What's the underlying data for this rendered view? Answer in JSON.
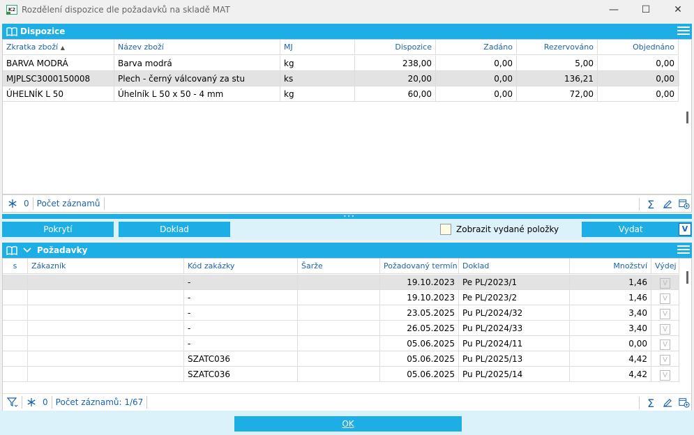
{
  "window": {
    "title": "Rozdělení dispozice dle požadavků na skladě MAT",
    "logo_text": "K2",
    "minimize": "—",
    "maximize": "☐",
    "close": "✕"
  },
  "dispozice": {
    "title": "Dispozice",
    "columns": [
      "Zkratka zboží",
      "Název zboží",
      "MJ",
      "Dispozice",
      "Zadáno",
      "Rezervováno",
      "Objednáno"
    ],
    "sort_indicator": "▲",
    "rows": [
      [
        "BARVA MODRÁ",
        "Barva modrá",
        "kg",
        "238,00",
        "0,00",
        "5,00",
        "0,00"
      ],
      [
        "MJPLSC3000150008",
        "Plech - černý válcovaný za stu",
        "ks",
        "20,00",
        "0,00",
        "136,21",
        "0,00"
      ],
      [
        "ÚHELNÍK L 50",
        "Úhelník L 50 x 50 - 4 mm",
        "kg",
        "60,00",
        "0,00",
        "72,00",
        "0,00"
      ]
    ],
    "footer": {
      "count": "0",
      "label": "Počet záznamů"
    }
  },
  "actions": {
    "pokryti": "Pokrytí",
    "doklad": "Doklad",
    "show_issued": "Zobrazit vydané položky",
    "vydat": "Vydat",
    "vydat_key": "V"
  },
  "pozadavky": {
    "title": "Požadavky",
    "columns": [
      "s",
      "Zákazník",
      "Kód zakázky",
      "Šarže",
      "Požadovaný termín",
      "Doklad",
      "Množství",
      "Výdej"
    ],
    "rows": [
      [
        "",
        "",
        "-",
        "",
        "19.10.2023",
        "Pe PL/2023/1",
        "1,46",
        "V"
      ],
      [
        "",
        "",
        "-",
        "",
        "19.10.2023",
        "Pe PL/2023/2",
        "1,46",
        "V"
      ],
      [
        "",
        "",
        "-",
        "",
        "23.05.2025",
        "Pu PL/2024/32",
        "3,40",
        "V"
      ],
      [
        "",
        "",
        "-",
        "",
        "26.05.2025",
        "Pu PL/2024/33",
        "3,40",
        "V"
      ],
      [
        "",
        "",
        "-",
        "",
        "05.06.2025",
        "Pu PL/2024/11",
        "0,00",
        "V"
      ],
      [
        "",
        "",
        "SZATC036",
        "",
        "05.06.2025",
        "Pu PL/2025/13",
        "4,42",
        "V"
      ],
      [
        "",
        "",
        "SZATC036",
        "",
        "05.06.2025",
        "Pu PL/2025/14",
        "4,42",
        "V"
      ]
    ],
    "footer": {
      "count": "0",
      "label": "Počet záznamů: 1/67"
    }
  },
  "ok_button": "OK",
  "colors": {
    "accent": "#1daee6",
    "link": "#1a62b0"
  }
}
